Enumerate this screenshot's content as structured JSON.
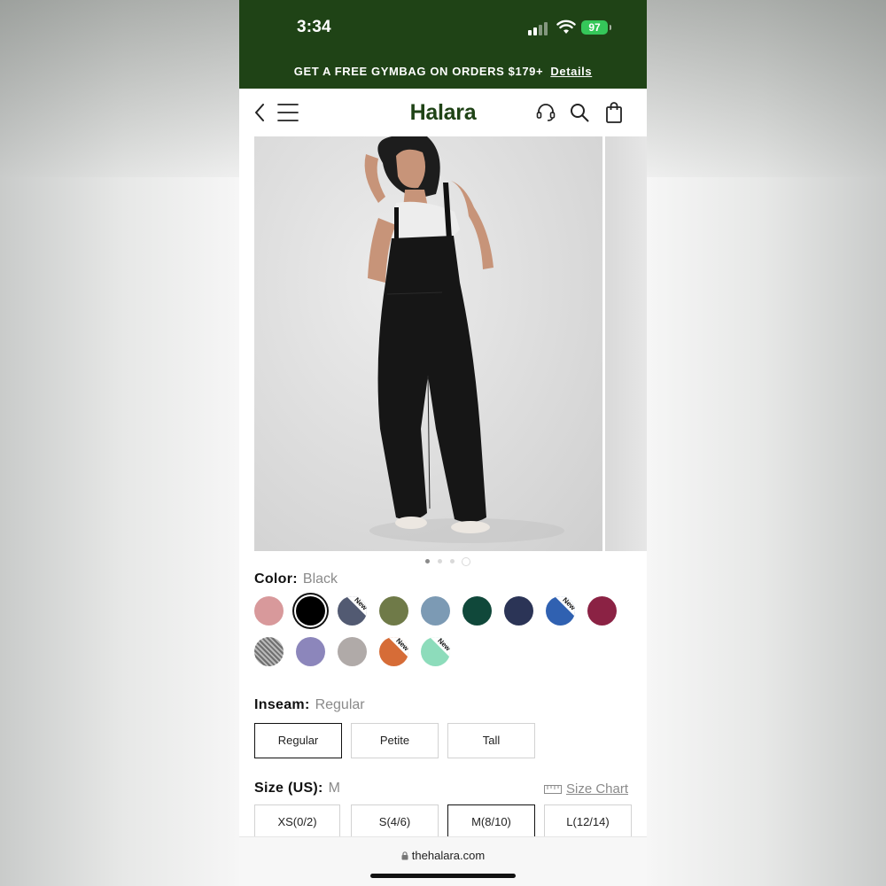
{
  "status_bar": {
    "time": "3:34",
    "battery": "97"
  },
  "promo": {
    "text": "GET A FREE GYMBAG ON ORDERS $179+",
    "link": "Details"
  },
  "nav": {
    "logo": "Halara"
  },
  "product": {
    "color_label": "Color:",
    "color_value": "Black",
    "colors": [
      {
        "hex": "#d8999b",
        "new": false,
        "selected": false
      },
      {
        "hex": "#000000",
        "new": false,
        "selected": true
      },
      {
        "hex": "#525a72",
        "new": true,
        "selected": false
      },
      {
        "hex": "#6f7a48",
        "new": false,
        "selected": false
      },
      {
        "hex": "#7c9ab4",
        "new": false,
        "selected": false
      },
      {
        "hex": "#10483a",
        "new": false,
        "selected": false
      },
      {
        "hex": "#2b3456",
        "new": false,
        "selected": false
      },
      {
        "hex": "#3061b1",
        "new": true,
        "selected": false
      },
      {
        "hex": "#8b2244",
        "new": false,
        "selected": false
      },
      {
        "hex": "#8e8e8e",
        "new": false,
        "selected": false,
        "pattern": "heather"
      },
      {
        "hex": "#8c86bb",
        "new": false,
        "selected": false
      },
      {
        "hex": "#b0aaa8",
        "new": false,
        "selected": false
      },
      {
        "hex": "#d66c37",
        "new": true,
        "selected": false
      },
      {
        "hex": "#8ddcbb",
        "new": true,
        "selected": false
      }
    ],
    "new_badge": "New",
    "inseam_label": "Inseam:",
    "inseam_value": "Regular",
    "inseam_options": [
      "Regular",
      "Petite",
      "Tall"
    ],
    "size_label": "Size (US):",
    "size_value": "M",
    "size_chart": "Size Chart",
    "size_options": [
      "XS(0/2)",
      "S(4/6)",
      "M(8/10)",
      "L(12/14)"
    ],
    "gallery_index": 0
  },
  "browser": {
    "url": "thehalara.com"
  },
  "colors": {
    "brand_green": "#1f4316",
    "battery_green": "#35c759"
  }
}
